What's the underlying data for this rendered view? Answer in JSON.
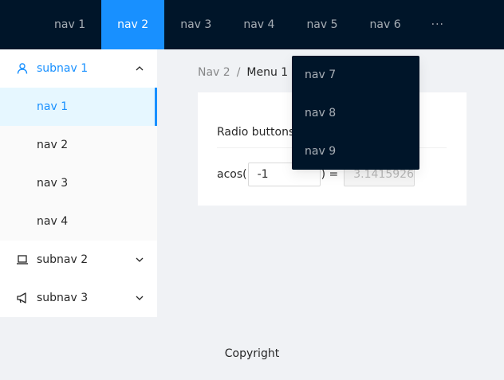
{
  "header": {
    "nav_items": [
      "nav 1",
      "nav 2",
      "nav 3",
      "nav 4",
      "nav 5",
      "nav 6"
    ],
    "active_index": 1,
    "more_label": "···"
  },
  "dropdown": {
    "items": [
      "nav 7",
      "nav 8",
      "nav 9"
    ]
  },
  "sider": {
    "subnavs": [
      {
        "label": "subnav 1",
        "icon": "user-icon",
        "open": true,
        "items": [
          "nav 1",
          "nav 2",
          "nav 3",
          "nav 4"
        ],
        "selected_index": 0
      },
      {
        "label": "subnav 2",
        "icon": "laptop-icon",
        "open": false
      },
      {
        "label": "subnav 3",
        "icon": "notification-icon",
        "open": false
      }
    ]
  },
  "breadcrumb": {
    "items": [
      "Nav 2",
      "Menu 1"
    ],
    "separator": "/"
  },
  "content": {
    "title": "Radio buttons",
    "formula_prefix": "acos(",
    "input_value": "-1",
    "formula_suffix": ") =",
    "result_value": "3.1415926"
  },
  "footer": {
    "text": "Copyright"
  },
  "colors": {
    "header_bg": "#001529",
    "primary": "#1890ff",
    "selected_bg": "#e6f7ff",
    "layout_bg": "#f0f2f5"
  }
}
